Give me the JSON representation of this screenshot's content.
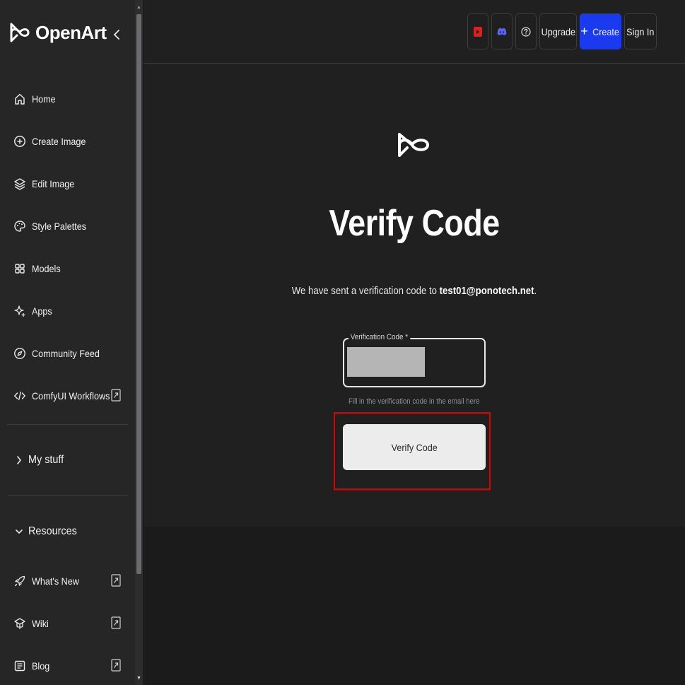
{
  "sidebar": {
    "brand": "OpenArt",
    "nav": [
      {
        "label": "Home",
        "icon": "home-icon"
      },
      {
        "label": "Create Image",
        "icon": "plus-circle-icon"
      },
      {
        "label": "Edit Image",
        "icon": "layers-icon"
      },
      {
        "label": "Style Palettes",
        "icon": "palette-icon"
      },
      {
        "label": "Models",
        "icon": "grid-icon"
      },
      {
        "label": "Apps",
        "icon": "sparkle-icon"
      },
      {
        "label": "Community Feed",
        "icon": "compass-icon"
      },
      {
        "label": "ComfyUI Workflows",
        "icon": "code-icon"
      }
    ],
    "my_stuff": "My stuff",
    "resources": "Resources",
    "resource_items": [
      {
        "label": "What's New",
        "icon": "rocket-icon"
      },
      {
        "label": "Wiki",
        "icon": "graduation-cap-icon"
      },
      {
        "label": "Blog",
        "icon": "newspaper-icon"
      }
    ]
  },
  "topbar": {
    "upgrade": "Upgrade",
    "create": "Create",
    "sign_in": "Sign In",
    "colors": {
      "youtube": "#e01e1e",
      "discord": "#5865f2",
      "create_bg": "#1a3af0"
    }
  },
  "form": {
    "title": "Verify Code",
    "subtitle_prefix": "We have sent a verification code to ",
    "email": "test01@ponotech.net",
    "subtitle_suffix": ".",
    "field_label": "Verification Code *",
    "field_value": "",
    "helper": "Fill in the verification code in the email here",
    "button": "Verify Code"
  }
}
